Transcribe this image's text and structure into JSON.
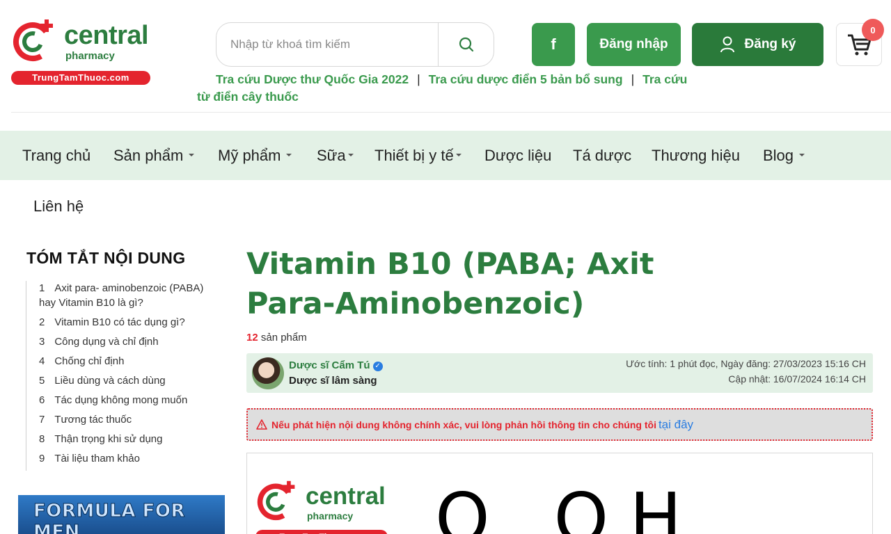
{
  "brand": {
    "name": "central",
    "sub": "pharmacy",
    "site": "TrungTamThuoc.com"
  },
  "search": {
    "placeholder": "Nhập từ khoá tìm kiếm",
    "icon": "search-icon"
  },
  "header_buttons": {
    "facebook": "f",
    "login": "Đăng nhập",
    "register": "Đăng ký",
    "cart_count": "0"
  },
  "quicklinks": [
    "Tra cứu Dược thư Quốc Gia 2022",
    "Tra cứu dược điển 5 bản bổ sung",
    "Tra cứu từ điển cây thuốc"
  ],
  "nav": {
    "items": [
      {
        "label": "Trang chủ",
        "dropdown": false
      },
      {
        "label": "Sản phẩm",
        "dropdown": true
      },
      {
        "label": "Mỹ phẩm",
        "dropdown": true
      },
      {
        "label": "Sữa",
        "dropdown": true
      },
      {
        "label": "Thiết bị y tế",
        "dropdown": true
      },
      {
        "label": "Dược liệu",
        "dropdown": false
      },
      {
        "label": "Tá dược",
        "dropdown": false
      },
      {
        "label": "Thương hiệu",
        "dropdown": false
      },
      {
        "label": "Blog",
        "dropdown": true
      }
    ],
    "second_row": "Liên hệ"
  },
  "toc": {
    "title": "TÓM TẮT NỘI DUNG",
    "items": [
      {
        "num": "1",
        "label": "Axit para- aminobenzoic (PABA) hay Vitamin B10 là gì?"
      },
      {
        "num": "2",
        "label": "Vitamin B10 có tác dụng gì?"
      },
      {
        "num": "3",
        "label": "Công dụng và chỉ định"
      },
      {
        "num": "4",
        "label": "Chống chỉ định"
      },
      {
        "num": "5",
        "label": "Liều dùng và cách dùng"
      },
      {
        "num": "6",
        "label": "Tác dụng không mong muốn"
      },
      {
        "num": "7",
        "label": "Tương tác thuốc"
      },
      {
        "num": "8",
        "label": "Thận trọng khi sử dụng"
      },
      {
        "num": "9",
        "label": "Tài liệu tham khảo"
      }
    ]
  },
  "promo": {
    "text": "FORMULA FOR MEN"
  },
  "article": {
    "title": "Vitamin B10 (PABA; Axit Para-Aminobenzoic)",
    "product_count": "12",
    "product_label": "sản phẩm",
    "author_name": "Dược sĩ Cẩm Tú",
    "author_role": "Dược sĩ lâm sàng",
    "meta_line1": "Ước tính: 1 phút đọc, Ngày đăng: 27/03/2023 15:16 CH",
    "meta_line2": "Cập nhật: 16/07/2024 16:14 CH",
    "warning": "Nếu phát hiện nội dung không chính xác, vui lòng phản hồi thông tin cho chúng tôi",
    "warning_link": "tại đây",
    "figure_formula": "O OH"
  },
  "colors": {
    "brand_green": "#2c7d3f",
    "button_green": "#3a9a4d",
    "nav_bg": "#e3f1e6",
    "accent_red": "#e4242e"
  }
}
